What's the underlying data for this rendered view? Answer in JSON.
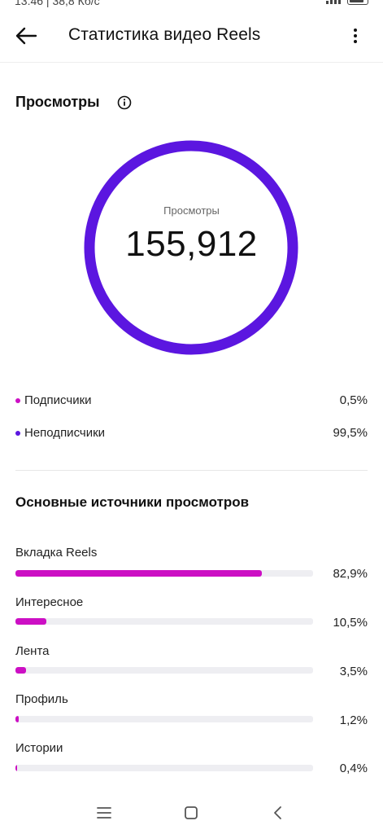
{
  "status_bar": {
    "text": "13:46 | 38,8 Кб/с"
  },
  "header": {
    "title": "Статистика видео Reels"
  },
  "views": {
    "section_title": "Просмотры",
    "donut_label": "Просмотры",
    "total": "155,912",
    "ring_color": "#5b16e0",
    "legend": [
      {
        "label": "Подписчики",
        "value": "0,5%",
        "color": "#cc0fc4"
      },
      {
        "label": "Неподписчики",
        "value": "99,5%",
        "color": "#5b16e0"
      }
    ]
  },
  "sources": {
    "section_title": "Основные источники просмотров",
    "bar_color": "#cc0fc4",
    "items": [
      {
        "label": "Вкладка Reels",
        "value": "82,9%",
        "fraction": 0.829
      },
      {
        "label": "Интересное",
        "value": "10,5%",
        "fraction": 0.105
      },
      {
        "label": "Лента",
        "value": "3,5%",
        "fraction": 0.035
      },
      {
        "label": "Профиль",
        "value": "1,2%",
        "fraction": 0.012
      },
      {
        "label": "Истории",
        "value": "0,4%",
        "fraction": 0.004
      }
    ]
  },
  "nav": {
    "icons": [
      "menu-icon",
      "home-icon",
      "back-icon"
    ]
  }
}
